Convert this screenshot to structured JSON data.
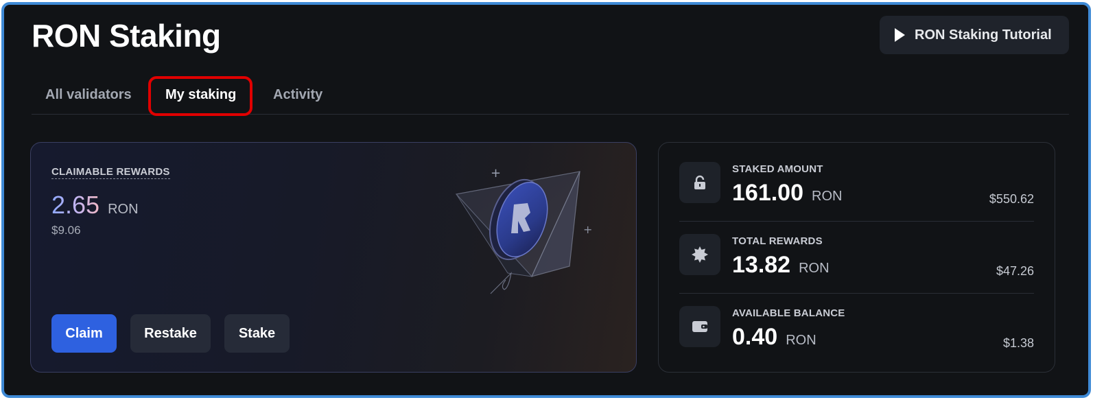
{
  "header": {
    "title": "RON Staking",
    "tutorial_label": "RON Staking Tutorial"
  },
  "tabs": [
    {
      "label": "All validators",
      "active": false
    },
    {
      "label": "My staking",
      "active": true
    },
    {
      "label": "Activity",
      "active": false
    }
  ],
  "rewards": {
    "label": "CLAIMABLE REWARDS",
    "amount": "2.65",
    "unit": "RON",
    "usd": "$9.06",
    "actions": {
      "claim": "Claim",
      "restake": "Restake",
      "stake": "Stake"
    }
  },
  "stats": [
    {
      "label": "STAKED AMOUNT",
      "value": "161.00",
      "unit": "RON",
      "usd": "$550.62",
      "icon": "lock-icon"
    },
    {
      "label": "TOTAL REWARDS",
      "value": "13.82",
      "unit": "RON",
      "usd": "$47.26",
      "icon": "star-badge-icon"
    },
    {
      "label": "AVAILABLE BALANCE",
      "value": "0.40",
      "unit": "RON",
      "usd": "$1.38",
      "icon": "wallet-icon"
    }
  ],
  "colors": {
    "accent": "#2e61e0",
    "highlight": "#e00000",
    "frame": "#3f8ad6",
    "background": "#111316"
  }
}
